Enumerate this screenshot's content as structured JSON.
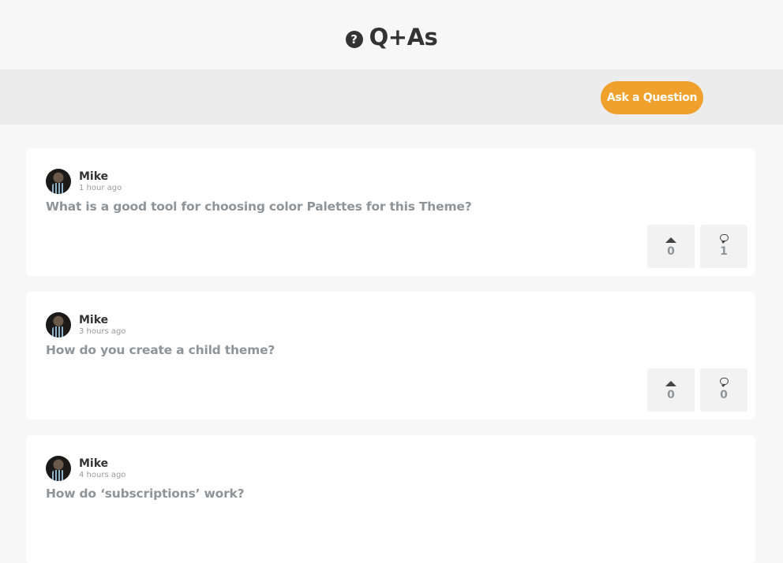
{
  "header": {
    "title": "Q+As",
    "icon": "help-circle-icon"
  },
  "toolbar": {
    "ask_label": "Ask a Question",
    "ask_color": "#f0a12d"
  },
  "questions": [
    {
      "author": "Mike",
      "time": "1 hour ago",
      "title": "What is a good tool for choosing color Palettes for this Theme?",
      "votes": "0",
      "comments": "1"
    },
    {
      "author": "Mike",
      "time": "3 hours ago",
      "title": "How do you create a child theme?",
      "votes": "0",
      "comments": "0"
    },
    {
      "author": "Mike",
      "time": "4 hours ago",
      "title": "How do ‘subscriptions’ work?",
      "votes": "",
      "comments": ""
    }
  ]
}
